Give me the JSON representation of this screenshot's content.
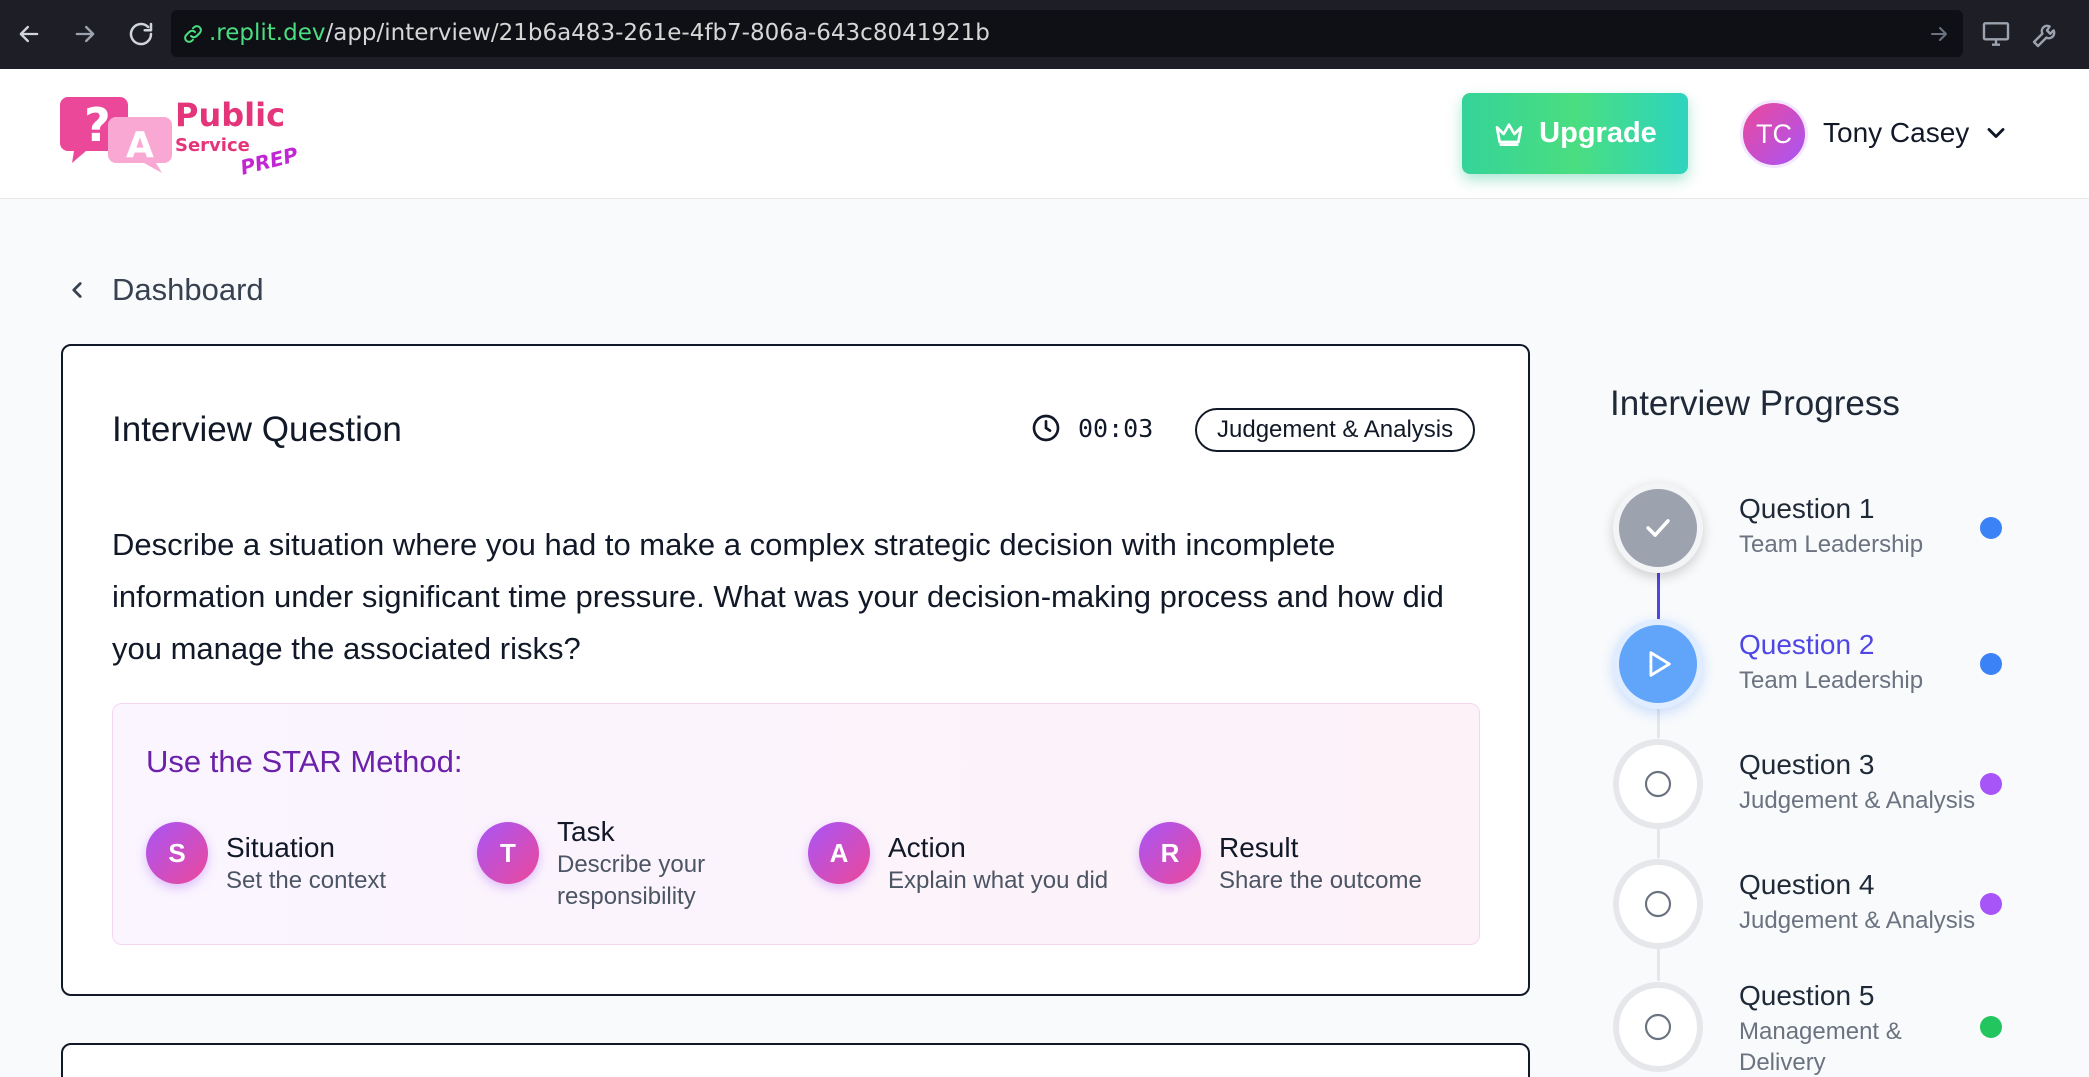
{
  "browser": {
    "url_host": ".replit.dev",
    "url_path": "/app/interview/21b6a483-261e-4fb7-806a-643c8041921b"
  },
  "header": {
    "logo": {
      "line1": "Public",
      "line2": "Service",
      "line3": "PREP",
      "icon_letter": "A"
    },
    "upgrade_label": "Upgrade",
    "user": {
      "initials": "TC",
      "name": "Tony Casey"
    }
  },
  "breadcrumb": {
    "back_label": "Dashboard"
  },
  "question": {
    "title": "Interview Question",
    "timer": "00:03",
    "category": "Judgement & Analysis",
    "text": "Describe a situation where you had to make a complex strategic decision with incomplete information under significant time pressure. What was your decision-making process and how did you manage the associated risks?"
  },
  "star": {
    "heading": "Use the STAR Method:",
    "items": [
      {
        "letter": "S",
        "title": "Situation",
        "desc": "Set the context"
      },
      {
        "letter": "T",
        "title": "Task",
        "desc": "Describe your responsibility"
      },
      {
        "letter": "A",
        "title": "Action",
        "desc": "Explain what you did"
      },
      {
        "letter": "R",
        "title": "Result",
        "desc": "Share the outcome"
      }
    ]
  },
  "progress": {
    "title": "Interview Progress",
    "items": [
      {
        "label": "Question 1",
        "category": "Team Leadership",
        "state": "completed",
        "dot_color": "#3b82f6"
      },
      {
        "label": "Question 2",
        "category": "Team Leadership",
        "state": "current",
        "dot_color": "#3b82f6"
      },
      {
        "label": "Question 3",
        "category": "Judgement & Analysis",
        "state": "upcoming",
        "dot_color": "#a855f7"
      },
      {
        "label": "Question 4",
        "category": "Judgement & Analysis",
        "state": "upcoming",
        "dot_color": "#a855f7"
      },
      {
        "label": "Question 5",
        "category": "Management & Delivery",
        "state": "upcoming",
        "dot_color": "#22c55e"
      }
    ]
  },
  "colors": {
    "accent": "#4f46e5",
    "upgrade": "#34d399",
    "star_gradient": [
      "#a855f7",
      "#ec4899"
    ]
  },
  "icons": {
    "back": "arrow-left-icon",
    "forward": "arrow-right-icon",
    "reload": "reload-icon",
    "link": "link-icon",
    "crown": "crown-icon",
    "chevron": "chevron-down-icon",
    "clock": "clock-icon",
    "check": "check-icon",
    "play": "play-icon",
    "circle": "circle-icon"
  }
}
